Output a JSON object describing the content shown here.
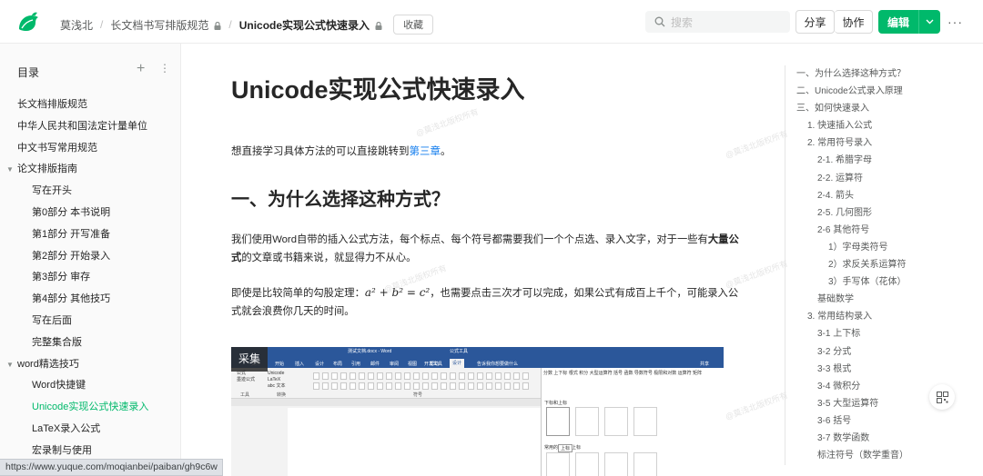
{
  "header": {
    "breadcrumbs": [
      "莫浅北",
      "长文档书写排版规范",
      "Unicode实现公式快速录入"
    ],
    "collect_label": "收藏",
    "search_placeholder": "搜索",
    "share_label": "分享",
    "collab_label": "协作",
    "edit_label": "编辑",
    "more_label": "···",
    "brand_color": "#00b96b"
  },
  "sidebar": {
    "title": "目录",
    "add_label": "+",
    "more_label": "⋮",
    "items": [
      {
        "label": "长文档排版规范"
      },
      {
        "label": "中华人民共和国法定计量单位"
      },
      {
        "label": "中文书写常用规范"
      },
      {
        "label": "论文排版指南",
        "expanded": true
      },
      {
        "label": "写在开头"
      },
      {
        "label": "第0部分 本书说明"
      },
      {
        "label": "第1部分 开写准备"
      },
      {
        "label": "第2部分 开始录入"
      },
      {
        "label": "第3部分 审存"
      },
      {
        "label": "第4部分 其他技巧"
      },
      {
        "label": "写在后面"
      },
      {
        "label": "完整集合版"
      },
      {
        "label": "word精选技巧",
        "expanded": true
      },
      {
        "label": "Word快捷键"
      },
      {
        "label": "Unicode实现公式快速录入",
        "active": true
      },
      {
        "label": "LaTeX录入公式"
      },
      {
        "label": "宏录制与使用"
      }
    ]
  },
  "status_url": "https://www.yuque.com/moqianbei/paiban/gh9c6w",
  "doc": {
    "title": "Unicode实现公式快速录入",
    "intro_prefix": "想直接学习具体方法的可以直接跳转到",
    "intro_link": "第三章",
    "intro_suffix": "。",
    "h1": "一、为什么选择这种方式？",
    "p1_a": "我们使用Word自带的插入公式方法，每个标点、每个符号都需要我们一个个点选、录入文字，对于一些有",
    "p1_bold": "大量公式",
    "p1_b": "的文章或书籍来说，就显得力不从心。",
    "p2_a": "即使是比较简单的勾股定理：",
    "p2_formula": "a² + b² = c²",
    "p2_b": "，也需要点击三次才可以完成，如果公式有成百上千个，可能录入公式就会浪费你几天的时间。",
    "watermark": "@莫浅北版权所有"
  },
  "screenshot": {
    "overlay_label": "采集",
    "window_title": "测试文档.docx - Word",
    "tool_title": "公式工具",
    "tell_me": "告诉我你想要做什么",
    "share": "共享",
    "tabs": [
      "文件",
      "开始",
      "插入",
      "设计",
      "布局",
      "引用",
      "邮件",
      "审阅",
      "视图",
      "开发工具",
      "帮助",
      "设计"
    ],
    "active_tab": "设计",
    "group_labels": [
      "工具",
      "转换",
      "符号"
    ],
    "left_tools": [
      "公式",
      "墨迹公式",
      "Unicode",
      "LaTeX",
      "abc 文本"
    ],
    "right_tools": [
      "分数",
      "上下标",
      "根式",
      "积分",
      "大型运算符",
      "括号",
      "函数",
      "导数符号",
      "极限和对数",
      "运算符",
      "矩阵"
    ],
    "panel_title": "下标和上标",
    "panel_sub": "常用的下标和上标",
    "tooltip": "上标"
  },
  "toc": {
    "items": [
      {
        "label": "一、为什么选择这种方式？",
        "level": 0
      },
      {
        "label": "二、Unicode公式录入原理",
        "level": 0
      },
      {
        "label": "三、如何快速录入",
        "level": 0
      },
      {
        "label": "1. 快速插入公式",
        "level": 1
      },
      {
        "label": "2. 常用符号录入",
        "level": 1
      },
      {
        "label": "2-1. 希腊字母",
        "level": 2
      },
      {
        "label": "2-2. 运算符",
        "level": 2
      },
      {
        "label": "2-4. 箭头",
        "level": 2
      },
      {
        "label": "2-5. 几何图形",
        "level": 2
      },
      {
        "label": "2-6 其他符号",
        "level": 2
      },
      {
        "label": "1）字母类符号",
        "level": 3
      },
      {
        "label": "2）求反关系运算符",
        "level": 3
      },
      {
        "label": "3）手写体（花体）",
        "level": 3
      },
      {
        "label": "基础数学",
        "level": 2
      },
      {
        "label": "3. 常用结构录入",
        "level": 1
      },
      {
        "label": "3-1 上下标",
        "level": 2
      },
      {
        "label": "3-2 分式",
        "level": 2
      },
      {
        "label": "3-3 根式",
        "level": 2
      },
      {
        "label": "3-4 微积分",
        "level": 2
      },
      {
        "label": "3-5 大型运算符",
        "level": 2
      },
      {
        "label": "3-6 括号",
        "level": 2
      },
      {
        "label": "3-7 数学函数",
        "level": 2
      },
      {
        "label": "标注符号（数学重音）",
        "level": 2
      }
    ]
  }
}
